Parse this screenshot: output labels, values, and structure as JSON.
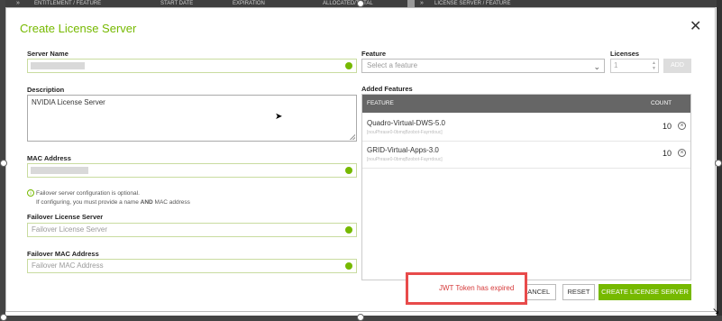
{
  "background_header": {
    "columns": [
      "ENTITLEMENT / FEATURE",
      "START DATE",
      "EXPIRATION",
      "ALLOCATED/TOTAL",
      "LICENSE SERVER / FEATURE"
    ]
  },
  "dialog": {
    "title": "Create License Server",
    "close_icon": "close-icon"
  },
  "form": {
    "server_name": {
      "label": "Server Name",
      "value": ""
    },
    "description": {
      "label": "Description",
      "value": "NVIDIA License Server"
    },
    "mac_address": {
      "label": "MAC Address",
      "value": ""
    },
    "failover_info": {
      "line1": "Failover server configuration is optional.",
      "line2_a": "If configuring, you must provide a name ",
      "line2_b": "AND",
      "line2_c": " MAC address"
    },
    "failover_server": {
      "label": "Failover License Server",
      "placeholder": "Failover License Server"
    },
    "failover_mac": {
      "label": "Failover MAC Address",
      "placeholder": "Failover MAC Address"
    }
  },
  "feature_picker": {
    "label": "Feature",
    "placeholder": "Select a feature",
    "licenses_label": "Licenses",
    "licenses_value": "1",
    "add_label": "ADD"
  },
  "added_features": {
    "title": "Added Features",
    "col_feature": "FEATURE",
    "col_count": "COUNT",
    "items": [
      {
        "name": "Quadro-Virtual-DWS-5.0",
        "id": "[nouPhrase0-0bmqBzobot-Fayrrdouc]",
        "count": "10"
      },
      {
        "name": "GRID-Virtual-Apps-3.0",
        "id": "[nouPhrase0-0bmqBzobot-Fayrrdouc]",
        "count": "10"
      }
    ]
  },
  "footer": {
    "error_message": "JWT Token has expired",
    "cancel_label": "CANCEL",
    "reset_label": "RESET",
    "create_label": "CREATE LICENSE SERVER"
  },
  "colors": {
    "brand_green": "#76b900",
    "error_red": "#e84b4b",
    "table_header": "#666666"
  }
}
